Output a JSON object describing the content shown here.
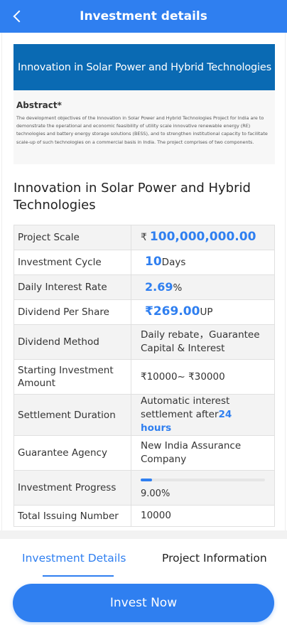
{
  "header": {
    "title": "Investment details"
  },
  "banner": {
    "heading": "Innovation in Solar Power and Hybrid Technologies",
    "abstract_title": "Abstract*",
    "abstract_text": "The development objectives of the Innovation in Solar Power and Hybrid Technologies Project for India are to demonstrate the operational and economic feasibility of utility scale innovative renewable energy (RE) technologies and battery energy storage solutions (BESS), and to strengthen institutional capacity to facilitate scale-up of such technologies on a commercial basis in India. The project comprises of two components."
  },
  "project": {
    "title": "Innovation in Solar Power and Hybrid Technologies"
  },
  "details": {
    "project_scale": {
      "label": "Project Scale",
      "currency": "₹",
      "value": "100,000,000.00"
    },
    "investment_cycle": {
      "label": "Investment Cycle",
      "value": "10",
      "unit": "Days"
    },
    "daily_interest_rate": {
      "label": "Daily Interest Rate",
      "value": "2.69",
      "unit": "%"
    },
    "dividend_per_share": {
      "label": "Dividend Per Share",
      "value": "₹269.00",
      "unit": "UP"
    },
    "dividend_method": {
      "label": "Dividend Method",
      "value": "Daily rebate，Guarantee Capital & Interest"
    },
    "starting_amount": {
      "label": "Starting Investment Amount",
      "value": "₹10000~ ₹30000"
    },
    "settlement_duration": {
      "label": "Settlement Duration",
      "value": "Automatic interest settlement after",
      "highlight": "24 hours"
    },
    "guarantee_agency": {
      "label": "Guarantee Agency",
      "value": "New India Assurance Company"
    },
    "investment_progress": {
      "label": "Investment Progress",
      "text": "9.00%",
      "fraction": 0.09
    },
    "total_issuing": {
      "label": "Total Issuing Number",
      "value": "10000"
    }
  },
  "tabs": [
    {
      "label": "Investment Details",
      "active": true
    },
    {
      "label": "Project Information",
      "active": false
    }
  ],
  "actions": {
    "invest_label": "Invest Now"
  },
  "colors": {
    "accent": "#2f7ff0",
    "banner": "#0a6ab3"
  }
}
